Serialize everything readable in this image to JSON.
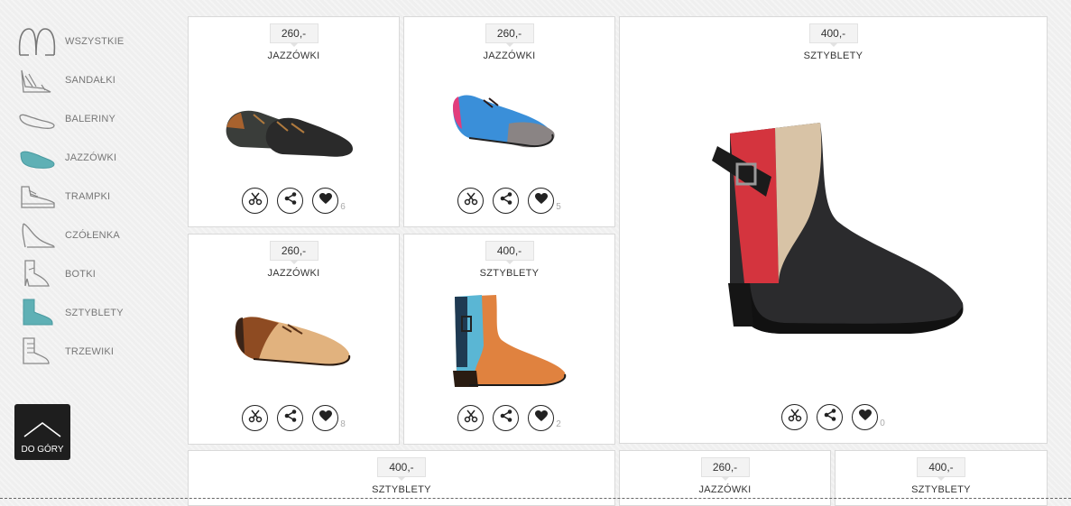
{
  "categories": [
    {
      "label": "WSZYSTKIE",
      "icon": "all-shoes-icon"
    },
    {
      "label": "SANDAŁKI",
      "icon": "sandal-icon"
    },
    {
      "label": "BALERINY",
      "icon": "ballerina-icon"
    },
    {
      "label": "JAZZÓWKI",
      "icon": "jazz-shoe-icon"
    },
    {
      "label": "TRAMPKI",
      "icon": "sneaker-icon"
    },
    {
      "label": "CZÓŁENKA",
      "icon": "pump-icon"
    },
    {
      "label": "BOTKI",
      "icon": "ankle-boot-icon"
    },
    {
      "label": "SZTYBLETY",
      "icon": "chelsea-boot-icon"
    },
    {
      "label": "TRZEWIKI",
      "icon": "lace-boot-icon"
    }
  ],
  "back_to_top": {
    "label": "DO GÓRY"
  },
  "products": [
    {
      "price": "260,-",
      "name": "JAZZÓWKI",
      "likes": "6"
    },
    {
      "price": "260,-",
      "name": "JAZZÓWKI",
      "likes": "5"
    },
    {
      "price": "400,-",
      "name": "SZTYBLETY",
      "likes": "0"
    },
    {
      "price": "260,-",
      "name": "JAZZÓWKI",
      "likes": "8"
    },
    {
      "price": "400,-",
      "name": "SZTYBLETY",
      "likes": "2"
    },
    {
      "price": "400,-",
      "name": "SZTYBLETY"
    },
    {
      "price": "260,-",
      "name": "JAZZÓWKI"
    },
    {
      "price": "400,-",
      "name": "SZTYBLETY"
    }
  ],
  "colors": {
    "accent_teal": "#5fb0b5",
    "button_dark": "#1e1e1e"
  }
}
